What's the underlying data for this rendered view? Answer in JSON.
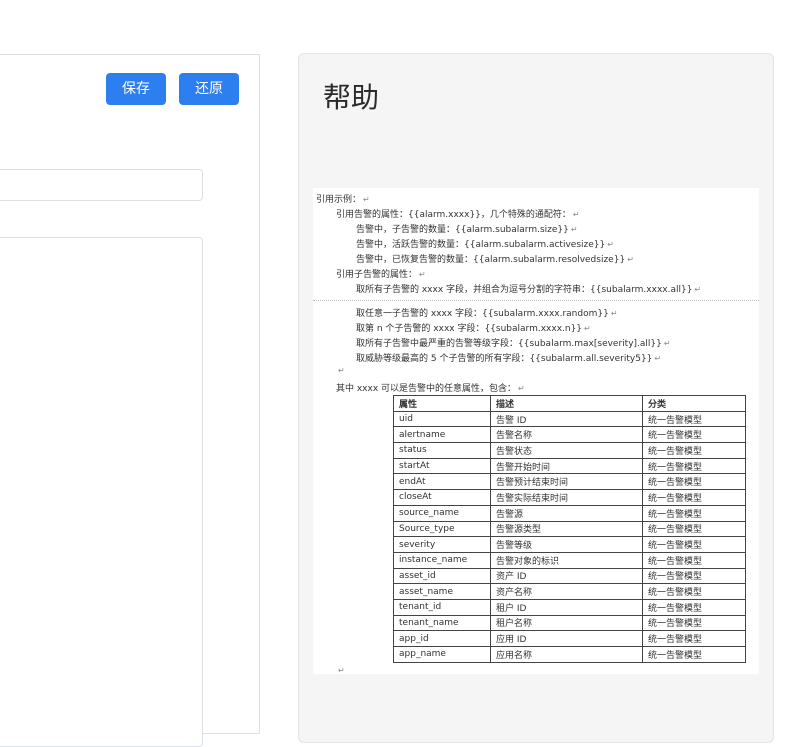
{
  "toolbar": {
    "save_label": "保存",
    "restore_label": "还原"
  },
  "help": {
    "title": "帮助",
    "doc": {
      "lines": [
        "引用示例：",
        "引用告警的属性：{{alarm.xxxx}}，几个特殊的通配符：",
        "告警中，子告警的数量：{{alarm.subalarm.size}}",
        "告警中，活跃告警的数量：{{alarm.subalarm.activesize}}",
        "告警中，已恢复告警的数量：{{alarm.subalarm.resolvedsize}}",
        "引用子告警的属性：",
        "取所有子告警的 xxxx 字段，并组合为逗号分割的字符串：{{subalarm.xxxx.all}}",
        "取任意一子告警的 xxxx 字段：{{subalarm.xxxx.random}}",
        "取第 n 个子告警的 xxxx 字段：{{subalarm.xxxx.n}}",
        "取所有子告警中最严重的告警等级字段：{{subalarm.max[severity].all}}",
        "取威胁等级最高的 5 个子告警的所有字段：{{subalarm.all.severity5}}",
        "其中 xxxx 可以是告警中的任意属性，包含："
      ],
      "table_headers": [
        "属性",
        "描述",
        "分类"
      ],
      "table_rows": [
        [
          "uid",
          "告警 ID",
          "统一告警模型"
        ],
        [
          "alertname",
          "告警名称",
          "统一告警模型"
        ],
        [
          "status",
          "告警状态",
          "统一告警模型"
        ],
        [
          "startAt",
          "告警开始时间",
          "统一告警模型"
        ],
        [
          "endAt",
          "告警预计结束时间",
          "统一告警模型"
        ],
        [
          "closeAt",
          "告警实际结束时间",
          "统一告警模型"
        ],
        [
          "source_name",
          "告警源",
          "统一告警模型"
        ],
        [
          "Source_type",
          "告警源类型",
          "统一告警模型"
        ],
        [
          "severity",
          "告警等级",
          "统一告警模型"
        ],
        [
          "instance_name",
          "告警对象的标识",
          "统一告警模型"
        ],
        [
          "asset_id",
          "资产 ID",
          "统一告警模型"
        ],
        [
          "asset_name",
          "资产名称",
          "统一告警模型"
        ],
        [
          "tenant_id",
          "租户 ID",
          "统一告警模型"
        ],
        [
          "tenant_name",
          "租户名称",
          "统一告警模型"
        ],
        [
          "app_id",
          "应用 ID",
          "统一告警模型"
        ],
        [
          "app_name",
          "应用名称",
          "统一告警模型"
        ]
      ]
    }
  }
}
